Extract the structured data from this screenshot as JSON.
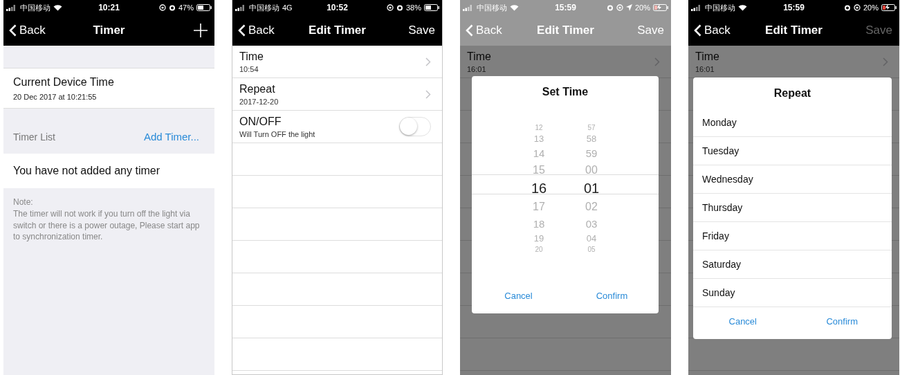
{
  "screens": [
    {
      "kind": "timer_list",
      "status": {
        "carrier": "中国移动",
        "network": {
          "kind": "wifi"
        },
        "time": "10:21",
        "indicators": [
          {
            "kind": "lock"
          },
          {
            "kind": "alarm"
          }
        ],
        "battery_text": "47%",
        "charging": false
      },
      "nav": {
        "back": "Back",
        "title": "Timer",
        "action": {
          "kind": "plus"
        },
        "dimmed": false
      },
      "device_time": {
        "label": "Current Device Time",
        "value": "20 Dec 2017 at 10:21:55"
      },
      "list_header": {
        "label": "Timer List",
        "link": "Add Timer..."
      },
      "empty_message": "You have not added any timer",
      "note": {
        "title": "Note:",
        "text": "The timer will not work if you turn off the light via switch or there is a power outage, Please start app to synchronization timer."
      }
    },
    {
      "kind": "edit_timer",
      "status": {
        "carrier": "中国移动",
        "network": {
          "kind": "text",
          "label": "4G"
        },
        "time": "10:52",
        "indicators": [
          {
            "kind": "lock"
          },
          {
            "kind": "alarm"
          }
        ],
        "battery_text": "38%",
        "charging": false
      },
      "nav": {
        "back": "Back",
        "title": "Edit Timer",
        "action": {
          "kind": "text",
          "label": "Save",
          "disabled": false
        },
        "dimmed": false
      },
      "rows": [
        {
          "kind": "link",
          "title": "Time",
          "value": "10:54"
        },
        {
          "kind": "link",
          "title": "Repeat",
          "value": "2017-12-20"
        },
        {
          "kind": "switch",
          "title": "ON/OFF",
          "value": "Will Turn OFF the light",
          "on": false
        }
      ]
    },
    {
      "kind": "edit_timer",
      "status": {
        "carrier": "中国移动",
        "network": {
          "kind": "wifi"
        },
        "time": "15:59",
        "indicators": [
          {
            "kind": "alarm"
          },
          {
            "kind": "lock"
          },
          {
            "kind": "location"
          }
        ],
        "battery_text": "20%",
        "charging": true
      },
      "nav": {
        "back": "Back",
        "title": "Edit Timer",
        "action": {
          "kind": "text",
          "label": "Save",
          "disabled": false
        },
        "dimmed": true
      },
      "rows": [
        {
          "kind": "link",
          "title": "Time",
          "value": "16:01"
        }
      ],
      "dialog": {
        "kind": "time_picker",
        "title": "Set Time",
        "columns": [
          [
            {
              "label": "12",
              "selected": false
            },
            {
              "label": "13",
              "selected": false
            },
            {
              "label": "14",
              "selected": false
            },
            {
              "label": "15",
              "selected": false
            },
            {
              "label": "16",
              "selected": true
            },
            {
              "label": "17",
              "selected": false
            },
            {
              "label": "18",
              "selected": false
            },
            {
              "label": "19",
              "selected": false
            },
            {
              "label": "20",
              "selected": false
            }
          ],
          [
            {
              "label": "57",
              "selected": false
            },
            {
              "label": "58",
              "selected": false
            },
            {
              "label": "59",
              "selected": false
            },
            {
              "label": "00",
              "selected": false
            },
            {
              "label": "01",
              "selected": true
            },
            {
              "label": "02",
              "selected": false
            },
            {
              "label": "03",
              "selected": false
            },
            {
              "label": "04",
              "selected": false
            },
            {
              "label": "05",
              "selected": false
            }
          ]
        ],
        "cancel": "Cancel",
        "confirm": "Confirm"
      }
    },
    {
      "kind": "edit_timer",
      "status": {
        "carrier": "中国移动",
        "network": {
          "kind": "wifi"
        },
        "time": "15:59",
        "indicators": [
          {
            "kind": "alarm"
          },
          {
            "kind": "lock"
          }
        ],
        "battery_text": "20%",
        "charging": true
      },
      "nav": {
        "back": "Back",
        "title": "Edit Timer",
        "action": {
          "kind": "text",
          "label": "Save",
          "disabled": true
        },
        "dimmed": false
      },
      "rows": [
        {
          "kind": "link",
          "title": "Time",
          "value": "16:01"
        }
      ],
      "dialog": {
        "kind": "day_list",
        "title": "Repeat",
        "items": [
          "Monday",
          "Tuesday",
          "Wednesday",
          "Thursday",
          "Friday",
          "Saturday",
          "Sunday"
        ],
        "cancel": "Cancel",
        "confirm": "Confirm"
      }
    }
  ]
}
